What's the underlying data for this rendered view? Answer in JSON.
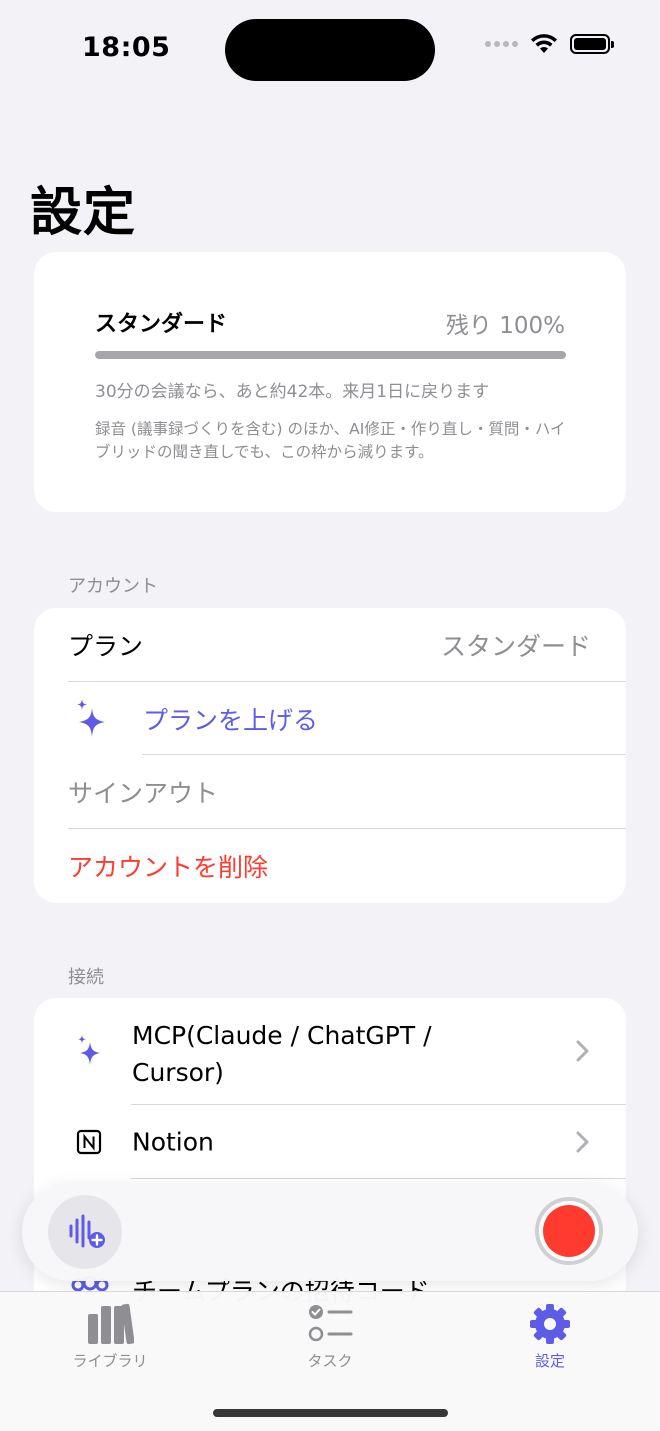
{
  "status_bar": {
    "time": "18:05"
  },
  "page": {
    "title": "設定"
  },
  "quota": {
    "plan": "スタンダード",
    "remaining": "残り 100%",
    "remaining_fraction": 1.0,
    "usage_note": "30分の会議なら、あと約42本。来月1日に戻ります",
    "detail_note": "録音 (議事録づくりを含む) のほか、AI修正・作り直し・質問・ハイブリッドの聞き直しでも、この枠から減ります。"
  },
  "account": {
    "header": "アカウント",
    "plan_label": "プラン",
    "plan_value": "スタンダード",
    "upgrade_label": "プランを上げる",
    "signout_label": "サインアウト",
    "delete_label": "アカウントを削除"
  },
  "connections": {
    "header": "接続",
    "mcp_label_line1": "MCP(Claude / ChatGPT /",
    "mcp_label_line2": "Cursor)",
    "notion_label": "Notion",
    "team_invite_label": "チームプランの招待コード"
  },
  "tabs": [
    {
      "label": "ライブラリ",
      "icon": "library-icon"
    },
    {
      "label": "タスク",
      "icon": "checklist-icon"
    },
    {
      "label": "設定",
      "icon": "gear-icon"
    }
  ],
  "colors": {
    "accent": "#5E5CE6",
    "destructive": "#FF3B30",
    "secondary_text": "#8E8E93",
    "background": "#F2F2F7"
  }
}
